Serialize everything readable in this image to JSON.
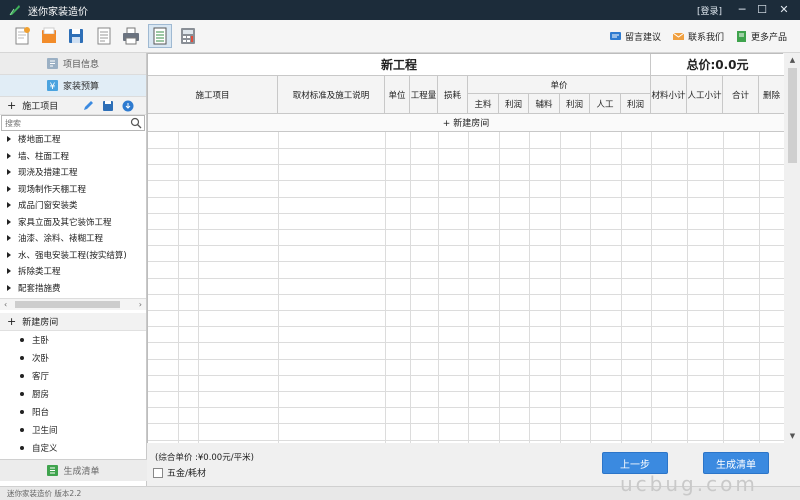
{
  "app": {
    "title": "迷你家装造价",
    "login": "[登录]",
    "minimize": "─",
    "maximize": "☐",
    "close": "✕"
  },
  "toolbar": {
    "buttons": [
      "new-file-icon",
      "open-folder-icon",
      "save-icon",
      "export-document-icon",
      "print-icon",
      "list-view-icon",
      "calculator-icon"
    ],
    "links": {
      "feedback": "留言建议",
      "contact": "联系我们",
      "more": "更多产品"
    }
  },
  "sidebar": {
    "nav": {
      "project_info": "项目信息",
      "budget": "家装预算"
    },
    "construction": {
      "header": "施工项目",
      "add": "+",
      "search_placeholder": "搜索"
    },
    "tree": [
      "楼地面工程",
      "墙、柱面工程",
      "现浇及措建工程",
      "现场制作天棚工程",
      "成品门窗安装类",
      "家具立面及其它装饰工程",
      "油漆、涂料、裱糊工程",
      "水、强电安装工程(按实结算)",
      "拆除类工程",
      "配套措施费"
    ],
    "scroll_left": "‹",
    "scroll_right": "›",
    "rooms": {
      "header": "新建房间",
      "add": "+",
      "items": [
        "主卧",
        "次卧",
        "客厅",
        "厨房",
        "阳台",
        "卫生间",
        "自定义"
      ]
    },
    "generate": "生成清单"
  },
  "table": {
    "title": "新工程",
    "total": "总价:0.0元",
    "headers": {
      "item": "施工项目",
      "standard": "取材标准及施工说明",
      "unit": "单位",
      "quantity": "工程量",
      "loss": "损耗",
      "unit_price": "单价",
      "main_material": "主料",
      "profit1": "利润",
      "aux_material": "辅料",
      "profit2": "利润",
      "labor": "人工",
      "profit3": "利润",
      "material_subtotal": "材料小计",
      "labor_subtotal": "人工小计",
      "sum": "合计",
      "delete": "删除"
    },
    "add_room": "+ 新建房间"
  },
  "footer": {
    "unit_price": "(综合单价 :¥0.00元/平米)",
    "hardware": "五金/耗材",
    "prev": "上一步",
    "generate": "生成清单"
  },
  "status": {
    "text": "迷你家装造价  版本2.2"
  },
  "watermark": "ucbug.com",
  "colors": {
    "titlebar": "#1c2c3a",
    "button": "#3b8ae0",
    "nav_selected": "#e1edf6"
  }
}
